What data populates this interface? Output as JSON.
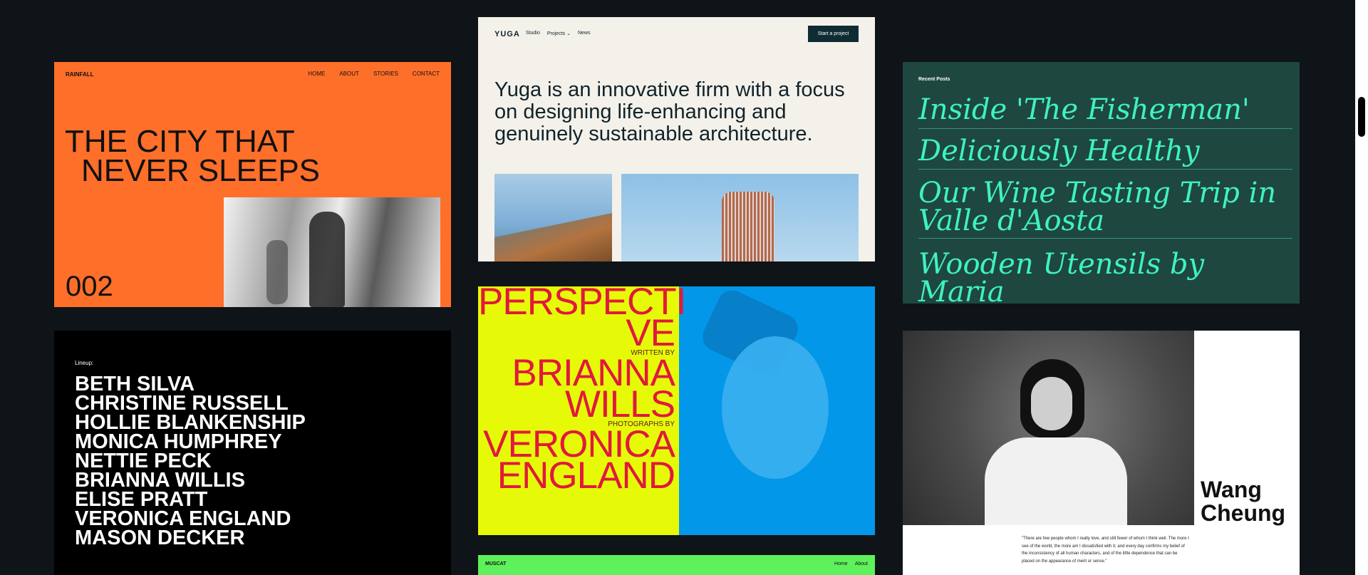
{
  "rainfall": {
    "logo": "RAINFALL",
    "nav": [
      "HOME",
      "ABOUT",
      "STORIES",
      "CONTACT"
    ],
    "headline_line1": "THE CITY THAT",
    "headline_line2": "NEVER SLEEPS",
    "issue_number": "002"
  },
  "yuga": {
    "logo": "YUGA",
    "nav": [
      "Studio",
      "Projects ⌄",
      "News"
    ],
    "cta": "Start a project",
    "headline": "Yuga is an innovative firm with a focus on designing life-enhancing and genuinely sustainable architecture."
  },
  "posts": {
    "label": "Recent Posts",
    "items": [
      "Inside 'The Fisherman'",
      "Deliciously Healthy",
      "Our Wine Tasting Trip in Valle d'Aosta",
      "Wooden Utensils by Maria"
    ]
  },
  "lineup": {
    "label": "Lineup:",
    "names": [
      "BETH SILVA",
      "CHRISTINE RUSSELL",
      "HOLLIE BLANKENSHIP",
      "MONICA HUMPHREY",
      "NETTIE PECK",
      "BRIANNA WILLIS",
      "ELISE PRATT",
      "VERONICA ENGLAND",
      "MASON DECKER"
    ]
  },
  "perspective": {
    "title_line1": "PERSPECTI",
    "title_line2": "VE",
    "written_by": "WRITTEN BY",
    "author_line1": "BRIANNA",
    "author_line2": "WILLS",
    "photographs_by": "PHOTOGRAPHS BY",
    "photographer_line1": "VERONICA",
    "photographer_line2": "ENGLAND"
  },
  "profile": {
    "name_line1": "Wang",
    "name_line2": "Cheung",
    "quote": "\"There are few people whom I really love, and still fewer of whom I think well. The more I see of the world, the more am I dissatisfied with it; and every day confirms my belief of the inconsistency of all human characters, and of the little dependence that can be placed on the appearance of merit or sense.\""
  },
  "muscat": {
    "logo": "MUSCAT",
    "nav": [
      "Home",
      "About"
    ]
  },
  "colors": {
    "background": "#0e1417",
    "rainfall_orange": "#fe6f2a",
    "yuga_cream": "#f4f1ea",
    "posts_green": "#1e4740",
    "posts_text": "#3ff2c0",
    "perspective_yellow": "#e6fa07",
    "perspective_red": "#e0193d",
    "perspective_blue": "#0397e9",
    "muscat_green": "#5df15c"
  }
}
